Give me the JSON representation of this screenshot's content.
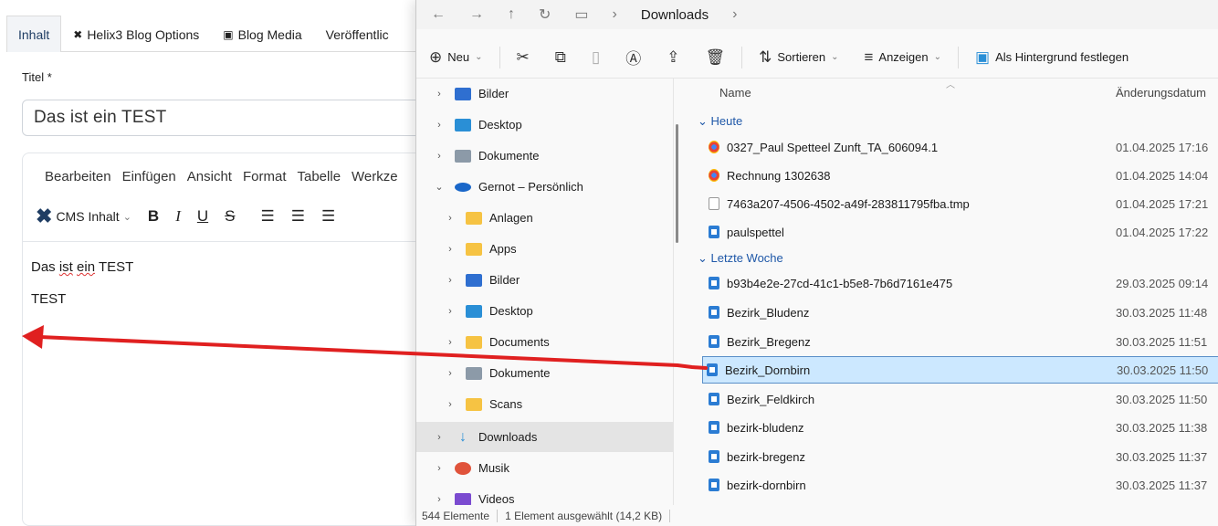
{
  "cms": {
    "tabs": [
      {
        "label": "Inhalt",
        "icon": ""
      },
      {
        "label": "Helix3 Blog Options",
        "icon": "cross-icon"
      },
      {
        "label": "Blog Media",
        "icon": "image-icon"
      },
      {
        "label": "Veröffentlic",
        "icon": ""
      }
    ],
    "title_label": "Titel *",
    "title_value": "Das ist ein TEST",
    "menubar": [
      "Bearbeiten",
      "Einfügen",
      "Ansicht",
      "Format",
      "Tabelle",
      "Werkze"
    ],
    "toolbar": {
      "cms_label": "CMS Inhalt",
      "buttons": [
        "B",
        "I",
        "U",
        "S"
      ]
    },
    "content": {
      "line1_a": "Das ",
      "line1_b": "ist",
      "line1_c": " ",
      "line1_d": "ein",
      "line1_e": " TEST",
      "line2": "TEST"
    }
  },
  "explorer": {
    "breadcrumb": "Downloads",
    "commands": {
      "new": "Neu",
      "sort": "Sortieren",
      "view": "Anzeigen",
      "wallpaper": "Als Hintergrund festlegen"
    },
    "nav": [
      {
        "label": "Bilder",
        "icon": "pictures-icon",
        "indent": 0,
        "selected": false
      },
      {
        "label": "Desktop",
        "icon": "desktop-icon",
        "indent": 0,
        "selected": false
      },
      {
        "label": "Dokumente",
        "icon": "documents-icon",
        "indent": 0,
        "selected": false
      },
      {
        "label": "Gernot – Persönlich",
        "icon": "onedrive-icon",
        "indent": 0,
        "selected": false
      },
      {
        "label": "Anlagen",
        "icon": "folder-icon",
        "indent": 1,
        "selected": false
      },
      {
        "label": "Apps",
        "icon": "folder-icon",
        "indent": 1,
        "selected": false
      },
      {
        "label": "Bilder",
        "icon": "pictures-icon",
        "indent": 1,
        "selected": false
      },
      {
        "label": "Desktop",
        "icon": "desktop-icon",
        "indent": 1,
        "selected": false
      },
      {
        "label": "Documents",
        "icon": "folder-icon",
        "indent": 1,
        "selected": false
      },
      {
        "label": "Dokumente",
        "icon": "documents-icon",
        "indent": 1,
        "selected": false
      },
      {
        "label": "Scans",
        "icon": "folder-icon",
        "indent": 1,
        "selected": false
      },
      {
        "label": "Downloads",
        "icon": "download-icon",
        "indent": 0,
        "selected": true
      },
      {
        "label": "Musik",
        "icon": "music-icon",
        "indent": 0,
        "selected": false
      },
      {
        "label": "Videos",
        "icon": "videos-icon",
        "indent": 0,
        "selected": false
      }
    ],
    "columns": {
      "name": "Name",
      "date": "Änderungsdatum"
    },
    "groups": [
      {
        "label": "Heute",
        "files": [
          {
            "name": "0327_Paul Spetteel Zunft_TA_606094.1",
            "date": "01.04.2025 17:16",
            "type": "chrome"
          },
          {
            "name": "Rechnung 1302638",
            "date": "01.04.2025 14:04",
            "type": "chrome"
          },
          {
            "name": "7463a207-4506-4502-a49f-283811795fba.tmp",
            "date": "01.04.2025 17:21",
            "type": "tmp"
          },
          {
            "name": "paulspettel",
            "date": "01.04.2025 17:22",
            "type": "word"
          }
        ]
      },
      {
        "label": "Letzte Woche",
        "files": [
          {
            "name": "b93b4e2e-27cd-41c1-b5e8-7b6d7161e475",
            "date": "29.03.2025 09:14",
            "type": "word"
          },
          {
            "name": "Bezirk_Bludenz",
            "date": "30.03.2025 11:48",
            "type": "word"
          },
          {
            "name": "Bezirk_Bregenz",
            "date": "30.03.2025 11:51",
            "type": "word"
          },
          {
            "name": "Bezirk_Dornbirn",
            "date": "30.03.2025 11:50",
            "type": "word",
            "selected": true
          },
          {
            "name": "Bezirk_Feldkirch",
            "date": "30.03.2025 11:50",
            "type": "word"
          },
          {
            "name": "bezirk-bludenz",
            "date": "30.03.2025 11:38",
            "type": "word"
          },
          {
            "name": "bezirk-bregenz",
            "date": "30.03.2025 11:37",
            "type": "word"
          },
          {
            "name": "bezirk-dornbirn",
            "date": "30.03.2025 11:37",
            "type": "word"
          }
        ]
      }
    ],
    "status": {
      "count": "544 Elemente",
      "selection": "1 Element ausgewählt (14,2 KB)"
    }
  },
  "colors": {
    "accent": "#1f58a8",
    "selection": "#cce8ff",
    "arrow": "#e02020"
  }
}
